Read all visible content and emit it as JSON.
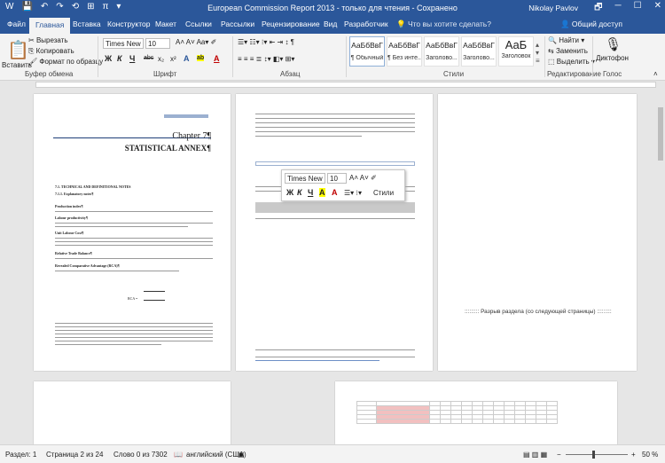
{
  "window": {
    "title": "European Commission Report 2013  -  только для чтения  -  Сохранено",
    "user": "Nikolay Pavlov",
    "controls": [
      "🗗",
      "─",
      "☐",
      "✕"
    ]
  },
  "qat": {
    "icons": [
      "W",
      "💾",
      "↶",
      "↷",
      "⟲",
      "⊞",
      "π",
      "▾"
    ]
  },
  "tabs": [
    "Файл",
    "Главная",
    "Вставка",
    "Конструктор",
    "Макет",
    "Ссылки",
    "Рассылки",
    "Рецензирование",
    "Вид",
    "Разработчик"
  ],
  "tell_me": "Что вы хотите сделать?",
  "share": "Общий доступ",
  "clipboard": {
    "paste": "Вставить",
    "cut": "Вырезать",
    "copy": "Копировать",
    "format_painter": "Формат по образцу",
    "label": "Буфер обмена"
  },
  "font": {
    "name": "Times New R",
    "size": "10",
    "label": "Шрифт",
    "buttons": [
      "Ж",
      "К",
      "Ч",
      "abc",
      "x₂",
      "x²",
      "A",
      "ab",
      "A"
    ]
  },
  "paragraph": {
    "label": "Абзац"
  },
  "styles": {
    "label": "Стили",
    "items": [
      {
        "preview": "АаБбВвГ",
        "name": "¶ Обычный"
      },
      {
        "preview": "АаБбВвГ",
        "name": "¶ Без инте..."
      },
      {
        "preview": "АаБбВвГ",
        "name": "Заголово..."
      },
      {
        "preview": "АаБбВвГ",
        "name": "Заголово..."
      },
      {
        "preview": "AaБ",
        "name": "Заголовок"
      }
    ]
  },
  "editing": {
    "find": "Найти",
    "replace": "Заменить",
    "select": "Выделить",
    "label": "Редактирование"
  },
  "voice": {
    "dictate": "Диктофон",
    "label": "Голос"
  },
  "page1": {
    "chapter": "Chapter 7¶",
    "title": "STATISTICAL ANNEX¶",
    "heading": "7.1. TECHNICAL AND DEFINITIONAL NOTES",
    "sub": "7.1.1. Explanatory notes¶",
    "sections": [
      "Production index¶",
      "Labour productivity¶",
      "Unit Labour Cost¶",
      "Relative Trade Balance¶",
      "Revealed Comparative Advantage (RCA)¶"
    ],
    "formula": "RCA ="
  },
  "page2": {
    "label": "Раздел"
  },
  "page3": {
    "section_break": "Разрыв раздела (со следующей страницы)"
  },
  "minitoolbar": {
    "font": "Times New R",
    "size": "10",
    "styles": "Стили",
    "buttons": [
      "Ж",
      "К",
      "Ч",
      "A",
      "A"
    ]
  },
  "status": {
    "section": "Раздел: 1",
    "page": "Страница 2 из 24",
    "words": "Слово 0 из 7302",
    "language": "английский (США)",
    "zoom": "50 %"
  }
}
